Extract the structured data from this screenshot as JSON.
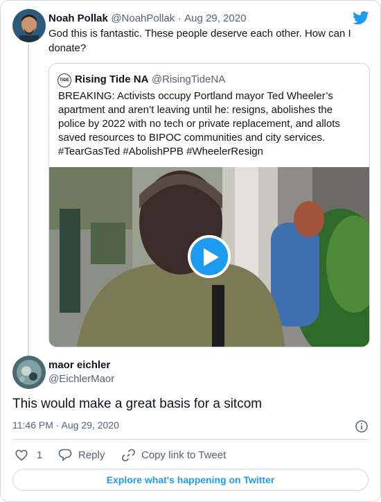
{
  "original_tweet": {
    "name": "Noah Pollak",
    "handle": "@NoahPollak",
    "separator": "·",
    "date": "Aug 29, 2020",
    "text_line1": "God this is fantastic. These people deserve each other. How can I",
    "text_line2": "donate?"
  },
  "quoted_tweet": {
    "name": "Rising Tide NA",
    "handle": "@RisingTideNA",
    "logo_text": "TIDE",
    "lines": [
      "BREAKING: Activists occupy Portland mayor Ted Wheeler’s",
      "apartment and aren’t leaving until he: resigns, abolishes the",
      "police by 2022 with no tech or private replacement, and allots",
      "saved resources to BIPOC communities and city services.",
      "#TearGasTed #AbolishPPB #WheelerResign"
    ]
  },
  "reply": {
    "name": "maor eichler",
    "handle": "@EichlerMaor",
    "text": "This would make a great basis for a sitcom",
    "time": "11:46 PM · Aug 29, 2020"
  },
  "actions": {
    "like_count": "1",
    "reply_label": "Reply",
    "copy_label": "Copy link to Tweet"
  },
  "footer": {
    "explore_label": "Explore what's happening on Twitter"
  },
  "icons": {
    "brand": "twitter-bird-icon",
    "play": "play-icon",
    "info": "info-icon",
    "heart": "heart-icon",
    "reply": "reply-icon",
    "link": "link-icon"
  },
  "colors": {
    "accent": "#1d9bf0",
    "text": "#0f1419",
    "muted": "#536471",
    "border": "#cfd9de"
  }
}
